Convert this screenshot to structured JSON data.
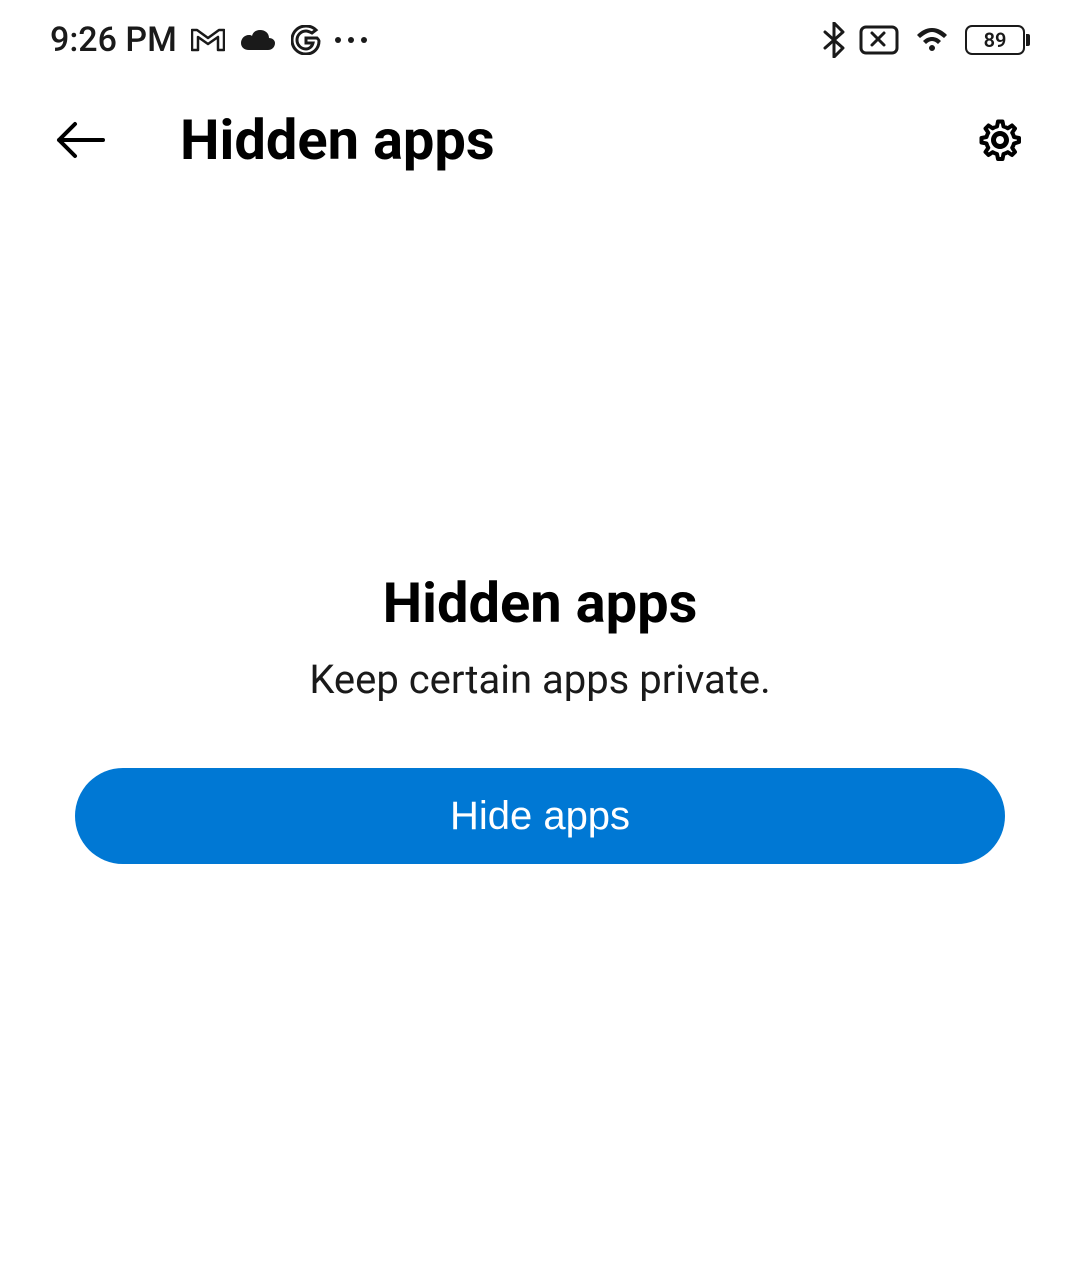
{
  "status_bar": {
    "time": "9:26 PM",
    "battery_level": "89",
    "icons_left": [
      "gmail-icon",
      "cloud-icon",
      "google-icon",
      "more-dots-icon"
    ],
    "icons_right": [
      "bluetooth-icon",
      "do-not-disturb-icon",
      "wifi-icon",
      "battery-icon"
    ]
  },
  "app_bar": {
    "title": "Hidden apps"
  },
  "content": {
    "title": "Hidden apps",
    "subtitle": "Keep certain apps private.",
    "button_label": "Hide apps"
  },
  "colors": {
    "primary_button": "#0078d4",
    "text": "#000000",
    "background": "#ffffff"
  }
}
